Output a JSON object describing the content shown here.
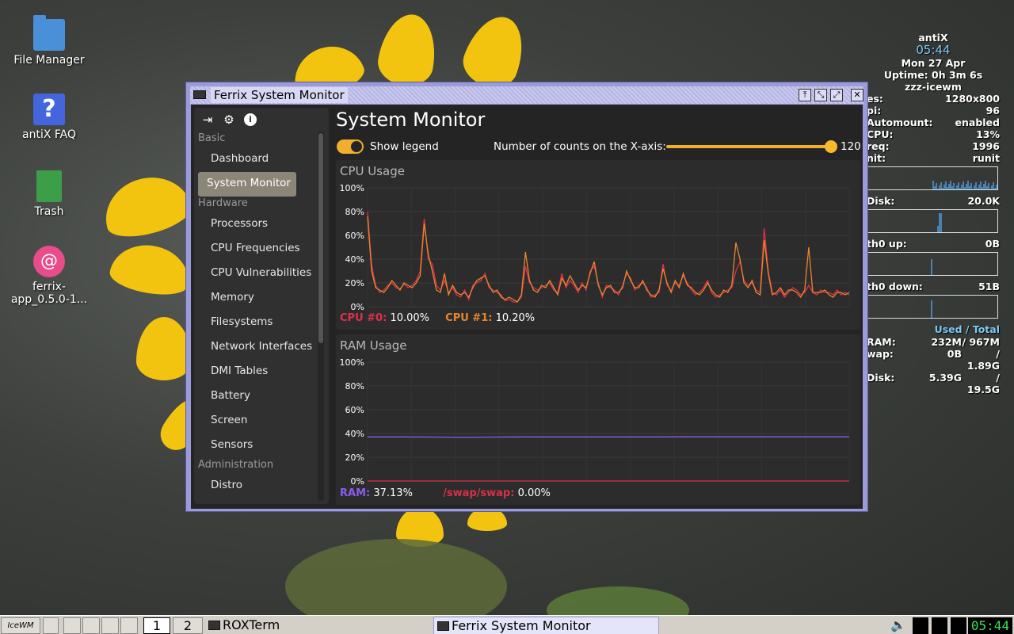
{
  "desktop": {
    "icons": [
      {
        "label": "File Manager",
        "icon": "folder-home-icon"
      },
      {
        "label": "antiX FAQ",
        "icon": "help-icon"
      },
      {
        "label": "Trash",
        "icon": "trash-icon"
      },
      {
        "label": "ferrix-app_0.5.0-1...",
        "icon": "debian-package-icon"
      }
    ]
  },
  "conky": {
    "hostname": "antiX",
    "time": "05:44",
    "date": "Mon 27 Apr",
    "uptime": "Uptime: 0h 3m 6s",
    "wm": "zzz-icewm",
    "rows": [
      {
        "label": "es:",
        "value": "1280x800"
      },
      {
        "label": "pi:",
        "value": "96"
      },
      {
        "label": "Automount:",
        "value": "enabled"
      },
      {
        "label": "CPU:",
        "value": "13%"
      },
      {
        "label": "req:",
        "value": "1996"
      },
      {
        "label": "nit:",
        "value": "runit"
      }
    ],
    "disk_label": "Disk:",
    "disk_value": "20.0K",
    "eth_up_label": "th0 up:",
    "eth_up_value": "0B",
    "eth_down_label": "th0 down:",
    "eth_down_value": "51B",
    "used_total": "Used / Total",
    "mem": [
      {
        "label": "RAM:",
        "used": "232M",
        "total": "/ 967M"
      },
      {
        "label": "wap:",
        "used": "0B",
        "total": "/ 1.89G"
      },
      {
        "label": "Disk:",
        "used": "5.39G",
        "total": "/ 19.5G"
      }
    ]
  },
  "window": {
    "title": "Ferrix System Monitor",
    "buttons": [
      "pin-icon",
      "minimize-icon",
      "maximize-icon",
      "close-icon"
    ]
  },
  "sidebar": {
    "sections": [
      {
        "title": "Basic",
        "items": [
          "Dashboard",
          "System Monitor"
        ]
      },
      {
        "title": "Hardware",
        "items": [
          "Processors",
          "CPU Frequencies",
          "CPU Vulnerabilities",
          "Memory",
          "Filesystems",
          "Network Interfaces",
          "DMI Tables",
          "Battery",
          "Screen",
          "Sensors"
        ]
      },
      {
        "title": "Administration",
        "items": [
          "Distro"
        ]
      }
    ],
    "active": "System Monitor"
  },
  "main": {
    "title": "System Monitor",
    "show_legend_label": "Show legend",
    "show_legend": true,
    "x_counts_label": "Number of counts on the X-axis:",
    "x_counts_value": "120",
    "x_counts_fraction": 1.0
  },
  "colors": {
    "accent": "#f2ae2f",
    "cpu0": "#e0304a",
    "cpu1": "#e8862e",
    "ram": "#8a5cf0",
    "swap": "#d8304a",
    "window_frame": "#9b9bd8"
  },
  "chart_data": [
    {
      "type": "line",
      "title": "CPU Usage",
      "ylim": [
        0,
        100
      ],
      "yticks": [
        "100%",
        "80%",
        "60%",
        "40%",
        "20%",
        "0%"
      ],
      "series": [
        {
          "name": "CPU #0:",
          "current": "10.00%",
          "values": [
            80,
            35,
            18,
            12,
            14,
            18,
            20,
            16,
            15,
            19,
            16,
            18,
            22,
            30,
            74,
            40,
            36,
            18,
            14,
            22,
            12,
            16,
            10,
            8,
            14,
            6,
            18,
            20,
            22,
            28,
            16,
            14,
            12,
            10,
            5,
            6,
            4,
            4,
            8,
            34,
            20,
            16,
            14,
            16,
            18,
            20,
            14,
            12,
            28,
            16,
            22,
            18,
            12,
            20,
            14,
            30,
            34,
            20,
            8,
            18,
            16,
            14,
            10,
            18,
            28,
            24,
            14,
            18,
            20,
            16,
            8,
            10,
            12,
            36,
            18,
            14,
            20,
            18,
            26,
            20,
            14,
            10,
            12,
            16,
            22,
            12,
            8,
            10,
            12,
            14,
            16,
            30,
            38,
            22,
            18,
            20,
            14,
            12,
            66,
            30,
            12,
            10,
            14,
            8,
            12,
            16,
            14,
            10,
            12,
            18,
            12,
            10,
            14,
            12,
            12,
            10,
            14,
            10,
            12,
            10
          ]
        },
        {
          "name": "CPU #1:",
          "current": "10.20%",
          "values": [
            76,
            30,
            16,
            14,
            12,
            16,
            22,
            18,
            14,
            20,
            18,
            16,
            20,
            26,
            70,
            44,
            30,
            14,
            12,
            28,
            10,
            18,
            12,
            10,
            12,
            8,
            16,
            22,
            24,
            26,
            18,
            12,
            14,
            8,
            6,
            8,
            6,
            4,
            10,
            46,
            22,
            14,
            12,
            18,
            16,
            22,
            16,
            10,
            24,
            18,
            26,
            20,
            14,
            18,
            16,
            28,
            38,
            18,
            10,
            16,
            18,
            12,
            12,
            16,
            30,
            22,
            16,
            16,
            22,
            14,
            10,
            8,
            14,
            32,
            20,
            12,
            22,
            16,
            28,
            18,
            16,
            12,
            10,
            14,
            20,
            14,
            10,
            8,
            14,
            12,
            18,
            54,
            40,
            20,
            16,
            22,
            12,
            10,
            56,
            28,
            10,
            12,
            16,
            10,
            14,
            14,
            12,
            8,
            14,
            50,
            12,
            12,
            12,
            14,
            10,
            8,
            12,
            12,
            10,
            12
          ]
        }
      ]
    },
    {
      "type": "line",
      "title": "RAM Usage",
      "ylim": [
        0,
        100
      ],
      "yticks": [
        "100%",
        "80%",
        "60%",
        "40%",
        "20%",
        "0%"
      ],
      "series": [
        {
          "name": "RAM:",
          "current": "37.13%",
          "values": [
            37.1,
            37.1,
            37.0,
            36.7,
            37.0,
            37.1,
            37.1,
            37.1,
            37.1,
            37.1,
            37.2,
            37.2,
            37.2,
            37.2,
            37.2,
            37.2
          ]
        },
        {
          "name": "/swap/swap:",
          "current": "0.00%",
          "values": [
            0,
            0,
            0,
            0,
            0,
            0,
            0,
            0,
            0,
            0,
            0,
            0,
            0,
            0,
            0,
            0
          ]
        }
      ]
    }
  ],
  "taskbar": {
    "start_label": "IceWM",
    "workspaces": [
      "1",
      "2"
    ],
    "tasks": [
      "ROXTerm",
      "Ferrix System Monitor"
    ],
    "clock": "05:44"
  }
}
